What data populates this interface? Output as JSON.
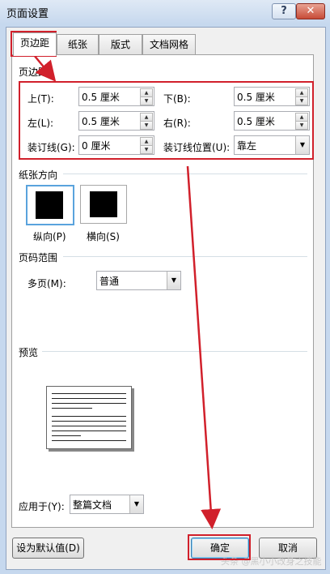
{
  "window": {
    "title": "页面设置",
    "help_label": "?",
    "close_label": "✕"
  },
  "tabs": [
    {
      "label": "页边距",
      "active": true
    },
    {
      "label": "纸张"
    },
    {
      "label": "版式"
    },
    {
      "label": "文档网格"
    }
  ],
  "margins": {
    "group_title": "页边距",
    "top": {
      "label": "上(T):",
      "value": "0.5 厘米"
    },
    "bottom": {
      "label": "下(B):",
      "value": "0.5 厘米"
    },
    "left": {
      "label": "左(L):",
      "value": "0.5 厘米"
    },
    "right": {
      "label": "右(R):",
      "value": "0.5 厘米"
    },
    "gutter": {
      "label": "装订线(G):",
      "value": "0 厘米"
    },
    "gutter_pos": {
      "label": "装订线位置(U):",
      "value": "靠左"
    }
  },
  "orientation": {
    "group_title": "纸张方向",
    "portrait_label": "纵向(P)",
    "landscape_label": "横向(S)",
    "selected": "portrait"
  },
  "pages": {
    "group_title": "页码范围",
    "multiple_label": "多页(M):",
    "multiple_value": "普通"
  },
  "preview": {
    "group_title": "预览"
  },
  "apply": {
    "label": "应用于(Y):",
    "value": "整篇文档"
  },
  "buttons": {
    "default": "设为默认值(D)",
    "ok": "确定",
    "cancel": "取消"
  },
  "watermark": "头条 @黑小小改身之技能",
  "colors": {
    "annotation_red": "#d1202b",
    "selection_blue": "#5aa3dd"
  }
}
